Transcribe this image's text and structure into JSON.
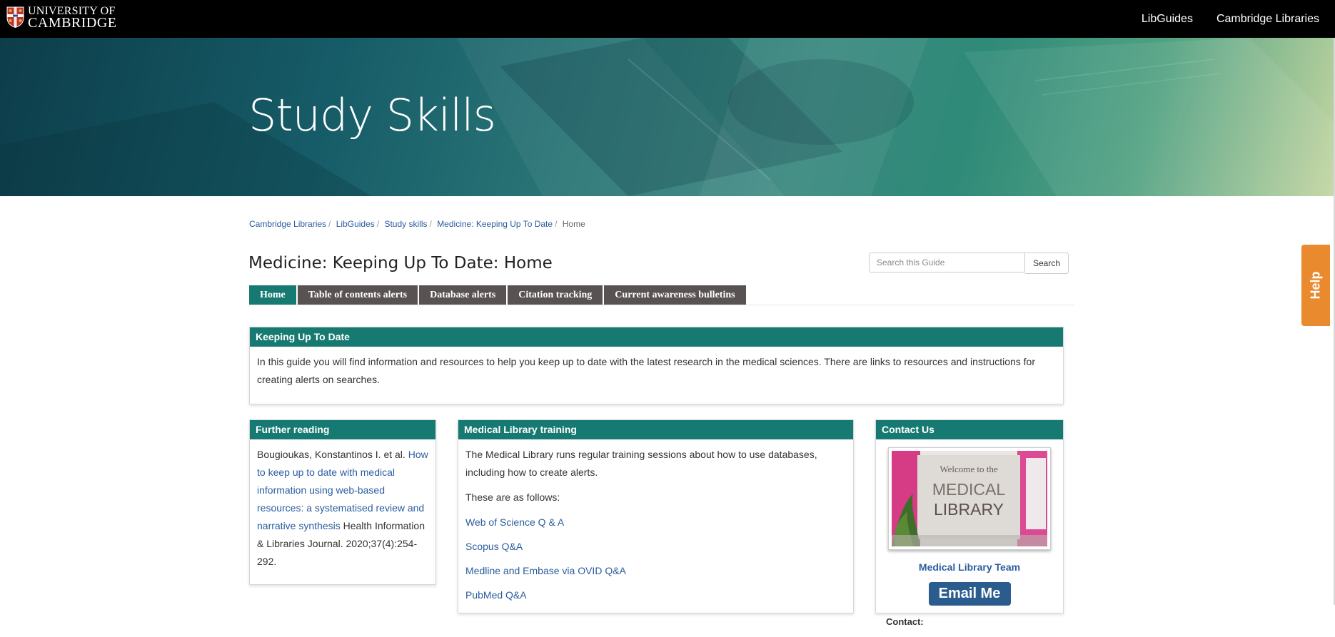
{
  "header": {
    "logo_line1": "UNIVERSITY OF",
    "logo_line2": "CAMBRIDGE",
    "links": [
      "LibGuides",
      "Cambridge Libraries"
    ]
  },
  "banner": {
    "title": "Study Skills"
  },
  "breadcrumb": [
    "Cambridge Libraries",
    "LibGuides",
    "Study skills",
    "Medicine: Keeping Up To Date",
    "Home"
  ],
  "page_title": "Medicine: Keeping Up To Date: Home",
  "search": {
    "placeholder": "Search this Guide",
    "button": "Search"
  },
  "tabs": [
    "Home",
    "Table of contents alerts",
    "Database alerts",
    "Citation tracking",
    "Current awareness bulletins"
  ],
  "keeping_up": {
    "title": "Keeping Up To Date",
    "text": "In this guide you will find information and resources to help you keep up to date with the latest research in the medical sciences. There are links to resources and instructions for creating alerts on searches."
  },
  "further_reading": {
    "title": "Further reading",
    "authors": "Bougioukas, Konstantinos I. et al. ",
    "link": "How to keep up to date with medical information using web-based resources: a systematised review and narrative synthesis",
    "citation": " Health Information & Libraries Journal. 2020;37(4):254-292."
  },
  "training": {
    "title": "Medical Library training",
    "intro": "The Medical Library runs regular training sessions about how to use databases, including how to create alerts.",
    "follows": "These are as follows:",
    "links": [
      "Web of Science Q & A",
      "Scopus Q&A",
      "Medline and Embase via OVID Q&A",
      "PubMed Q&A"
    ]
  },
  "contact": {
    "title": "Contact Us",
    "image_sign_line1": "Welcome to the",
    "image_sign_line2": "MEDICAL",
    "image_sign_line3": "LIBRARY",
    "team_link": "Medical Library Team",
    "email_button": "Email Me",
    "contact_label": "Contact:"
  },
  "help_tab": "Help",
  "colors": {
    "teal": "#177a72",
    "tab_grey": "#585252",
    "link": "#2a5d9f",
    "help_orange": "#ea8a2f",
    "email_blue": "#2a5d8e"
  }
}
